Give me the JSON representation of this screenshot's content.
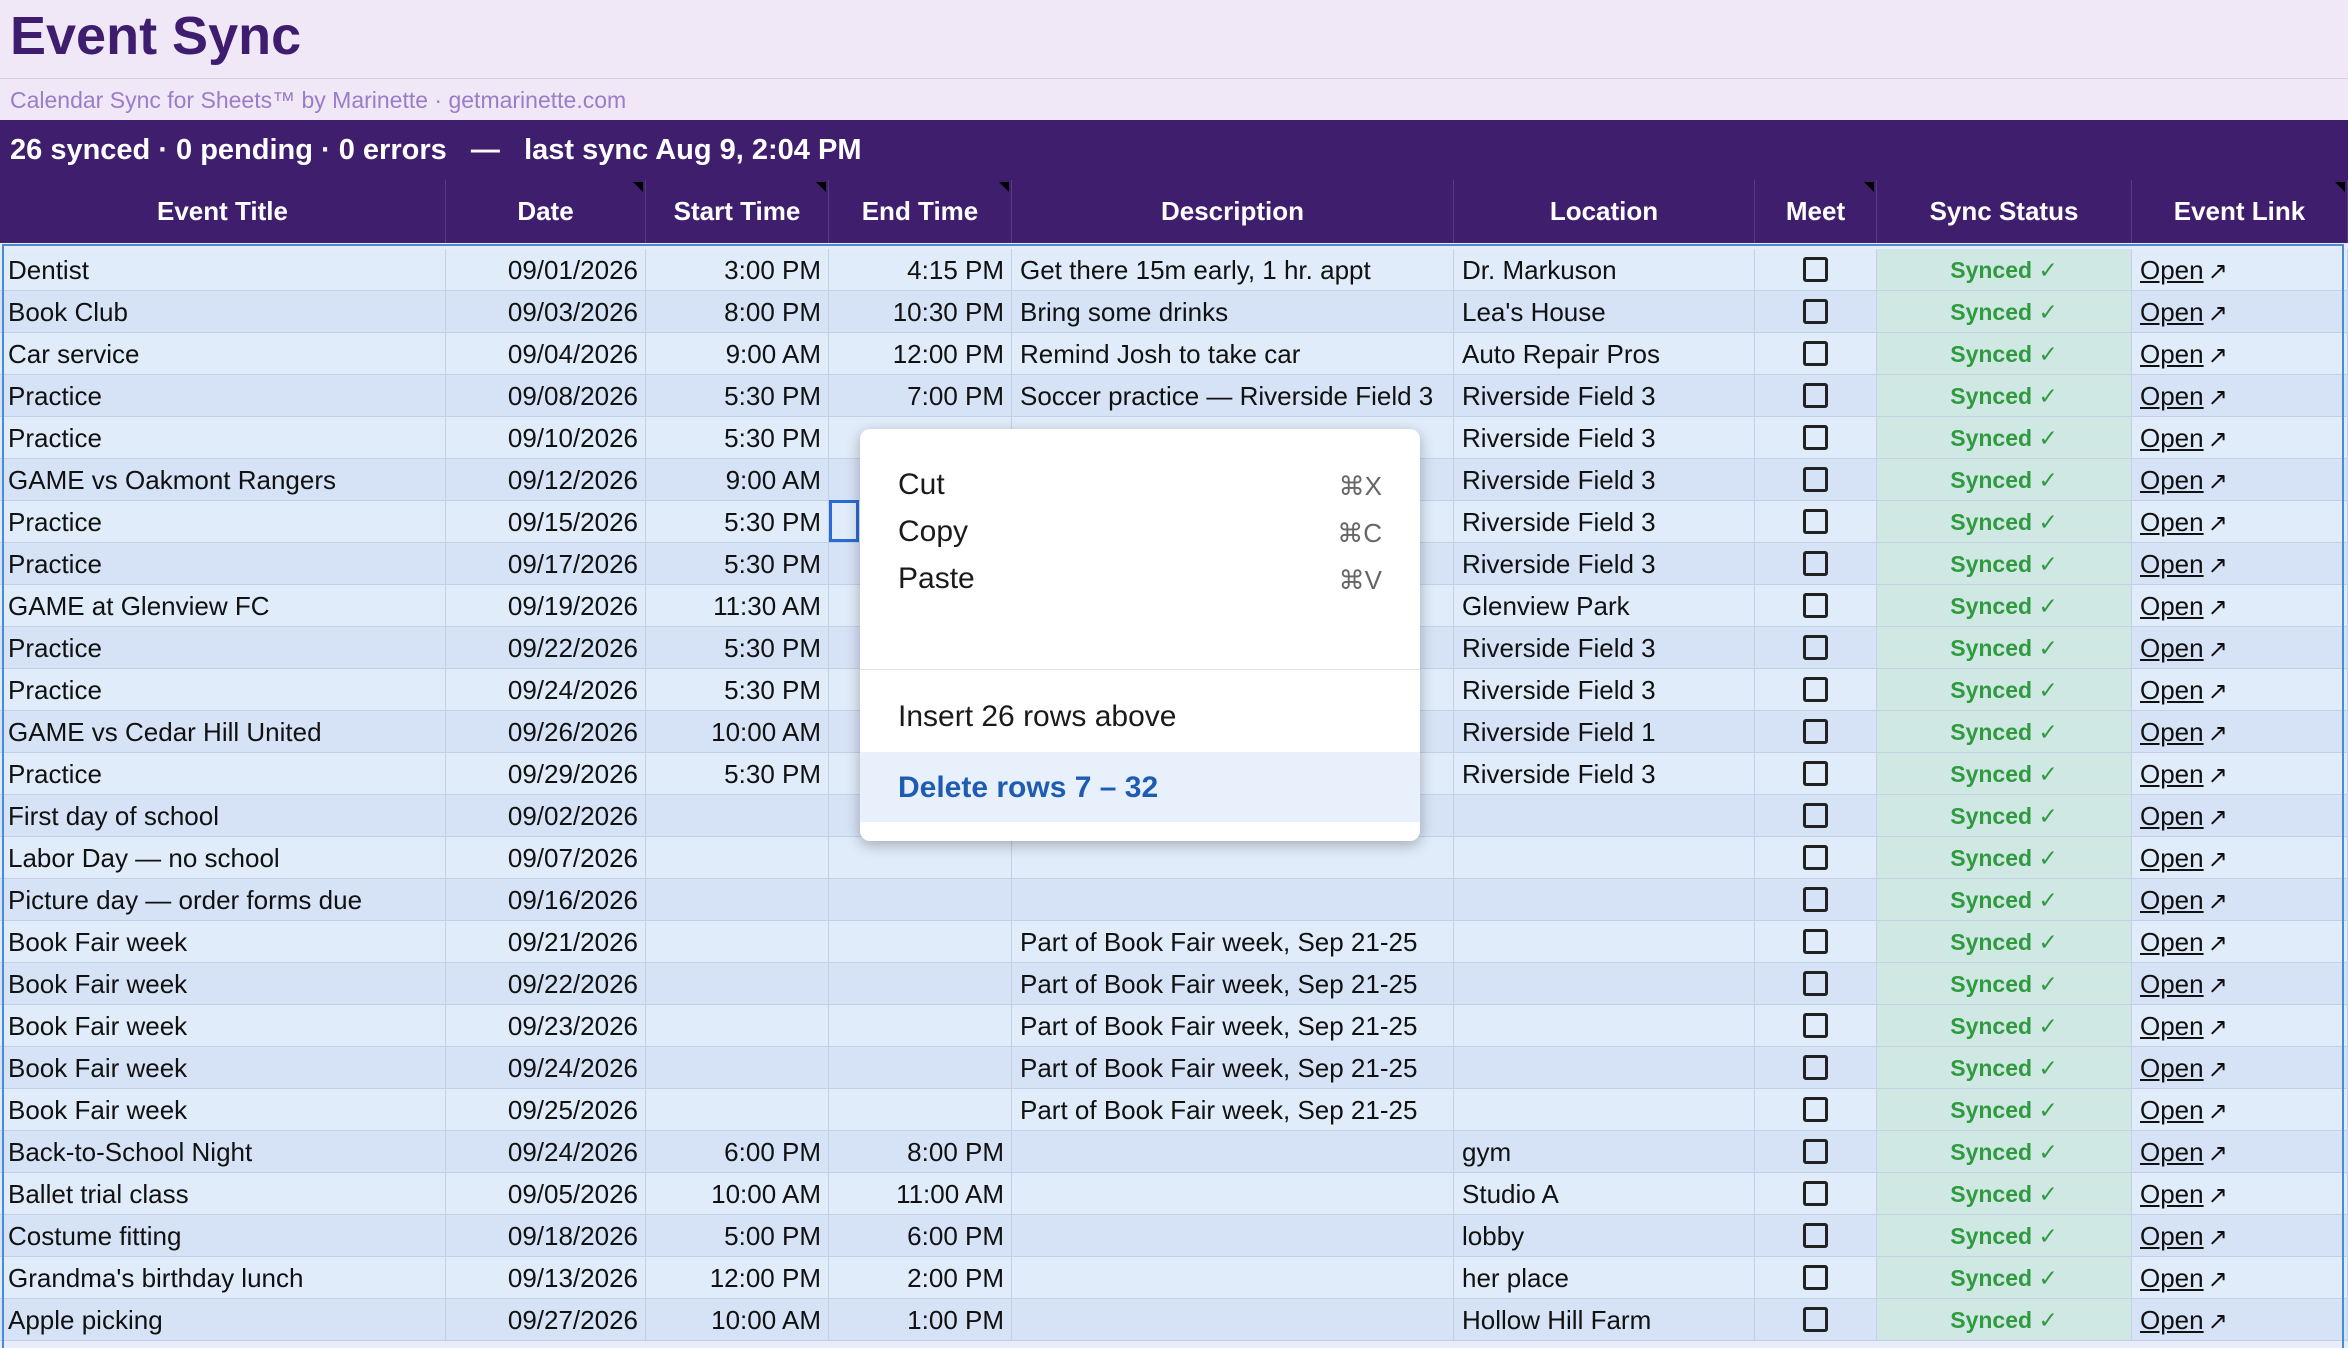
{
  "app": {
    "title": "Event Sync",
    "subtitle": "Calendar Sync for Sheets™ by Marinette · getmarinette.com",
    "status": "26 synced · 0 pending · 0 errors   —   last sync Aug 9, 2:04 PM"
  },
  "columns": [
    "Event Title",
    "Date",
    "Start Time",
    "End Time",
    "Description",
    "Location",
    "Meet",
    "Sync Status",
    "Event Link"
  ],
  "sync_label": "Synced ✓",
  "link_label": "Open",
  "link_icon": "external-link-icon",
  "rows": [
    {
      "title": "Dentist",
      "date": "09/01/2026",
      "start": "3:00 PM",
      "end": "4:15 PM",
      "desc": "Get there 15m early, 1 hr. appt",
      "loc": "Dr. Markuson"
    },
    {
      "title": "Book Club",
      "date": "09/03/2026",
      "start": "8:00 PM",
      "end": "10:30 PM",
      "desc": "Bring some drinks",
      "loc": "Lea's House"
    },
    {
      "title": "Car service",
      "date": "09/04/2026",
      "start": "9:00 AM",
      "end": "12:00 PM",
      "desc": "Remind Josh to take car",
      "loc": "Auto Repair Pros"
    },
    {
      "title": "Practice",
      "date": "09/08/2026",
      "start": "5:30 PM",
      "end": "7:00 PM",
      "desc": "Soccer practice — Riverside Field 3",
      "loc": "Riverside Field 3"
    },
    {
      "title": "Practice",
      "date": "09/10/2026",
      "start": "5:30 PM",
      "end": "",
      "desc": "",
      "loc": "Riverside Field 3"
    },
    {
      "title": "GAME vs Oakmont Rangers",
      "date": "09/12/2026",
      "start": "9:00 AM",
      "end": "",
      "desc": "",
      "loc": "Riverside Field 3"
    },
    {
      "title": "Practice",
      "date": "09/15/2026",
      "start": "5:30 PM",
      "end": "",
      "desc": "",
      "loc": "Riverside Field 3"
    },
    {
      "title": "Practice",
      "date": "09/17/2026",
      "start": "5:30 PM",
      "end": "",
      "desc": "",
      "loc": "Riverside Field 3"
    },
    {
      "title": "GAME at Glenview FC",
      "date": "09/19/2026",
      "start": "11:30 AM",
      "end": "",
      "desc": "",
      "loc": "Glenview Park"
    },
    {
      "title": "Practice",
      "date": "09/22/2026",
      "start": "5:30 PM",
      "end": "",
      "desc": "",
      "loc": "Riverside Field 3"
    },
    {
      "title": "Practice",
      "date": "09/24/2026",
      "start": "5:30 PM",
      "end": "",
      "desc": "",
      "loc": "Riverside Field 3"
    },
    {
      "title": "GAME vs Cedar Hill United",
      "date": "09/26/2026",
      "start": "10:00 AM",
      "end": "",
      "desc": "",
      "loc": "Riverside Field 1"
    },
    {
      "title": "Practice",
      "date": "09/29/2026",
      "start": "5:30 PM",
      "end": "",
      "desc": "",
      "loc": "Riverside Field 3"
    },
    {
      "title": "First day of school",
      "date": "09/02/2026",
      "start": "",
      "end": "",
      "desc": "",
      "loc": ""
    },
    {
      "title": "Labor Day — no school",
      "date": "09/07/2026",
      "start": "",
      "end": "",
      "desc": "",
      "loc": ""
    },
    {
      "title": "Picture day — order forms due",
      "date": "09/16/2026",
      "start": "",
      "end": "",
      "desc": "",
      "loc": ""
    },
    {
      "title": "Book Fair week",
      "date": "09/21/2026",
      "start": "",
      "end": "",
      "desc": "Part of Book Fair week, Sep 21-25",
      "loc": ""
    },
    {
      "title": "Book Fair week",
      "date": "09/22/2026",
      "start": "",
      "end": "",
      "desc": "Part of Book Fair week, Sep 21-25",
      "loc": ""
    },
    {
      "title": "Book Fair week",
      "date": "09/23/2026",
      "start": "",
      "end": "",
      "desc": "Part of Book Fair week, Sep 21-25",
      "loc": ""
    },
    {
      "title": "Book Fair week",
      "date": "09/24/2026",
      "start": "",
      "end": "",
      "desc": "Part of Book Fair week, Sep 21-25",
      "loc": ""
    },
    {
      "title": "Book Fair week",
      "date": "09/25/2026",
      "start": "",
      "end": "",
      "desc": "Part of Book Fair week, Sep 21-25",
      "loc": ""
    },
    {
      "title": "Back-to-School Night",
      "date": "09/24/2026",
      "start": "6:00 PM",
      "end": "8:00 PM",
      "desc": "",
      "loc": "gym"
    },
    {
      "title": "Ballet trial class",
      "date": "09/05/2026",
      "start": "10:00 AM",
      "end": "11:00 AM",
      "desc": "",
      "loc": "Studio A"
    },
    {
      "title": "Costume fitting",
      "date": "09/18/2026",
      "start": "5:00 PM",
      "end": "6:00 PM",
      "desc": "",
      "loc": "lobby"
    },
    {
      "title": "Grandma's birthday lunch",
      "date": "09/13/2026",
      "start": "12:00 PM",
      "end": "2:00 PM",
      "desc": "",
      "loc": "her place"
    },
    {
      "title": "Apple picking",
      "date": "09/27/2026",
      "start": "10:00 AM",
      "end": "1:00 PM",
      "desc": "",
      "loc": "Hollow Hill Farm"
    }
  ],
  "context_menu": {
    "items": [
      {
        "label": "Cut",
        "shortcut": "⌘X"
      },
      {
        "label": "Copy",
        "shortcut": "⌘C"
      },
      {
        "label": "Paste",
        "shortcut": "⌘V"
      },
      {
        "label": "Insert 26 rows above",
        "shortcut": ""
      },
      {
        "label": "Delete rows 7 – 32",
        "shortcut": ""
      }
    ]
  },
  "colors": {
    "title": "#3e1d6e",
    "header_bg": "#3f1e6e",
    "synced": "#2f9a3e",
    "selection": "#4a8bd6",
    "menu_accent": "#1e5cb3"
  }
}
